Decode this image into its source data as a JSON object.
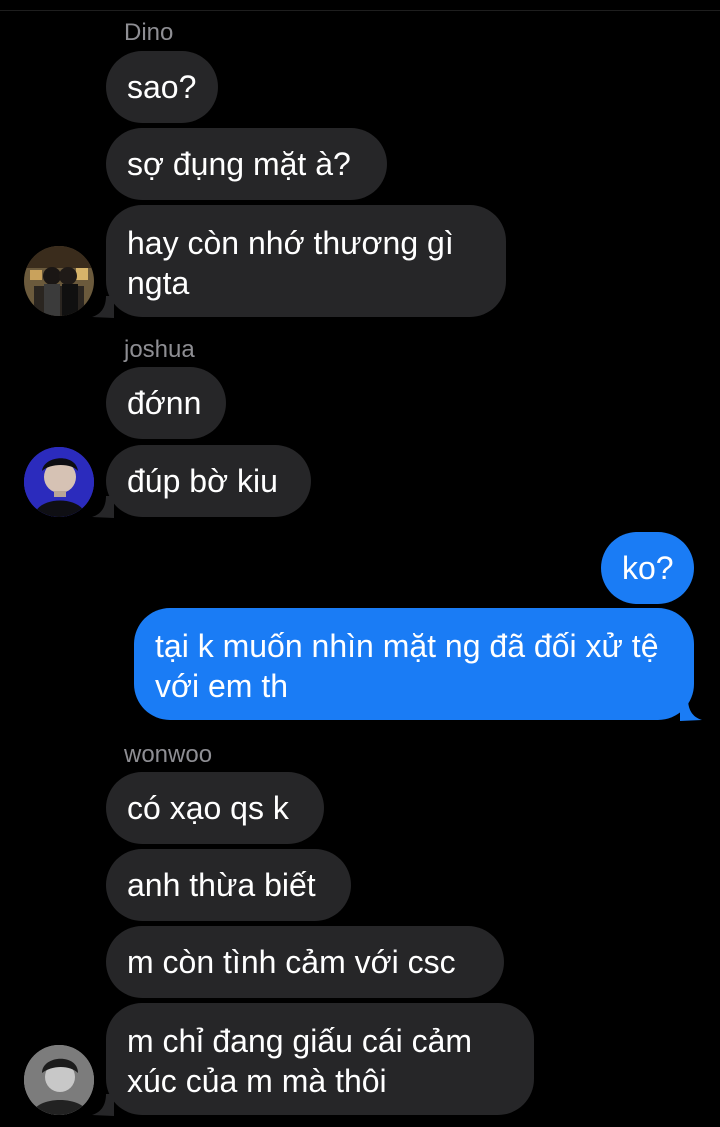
{
  "colors": {
    "background": "#000000",
    "incoming_bubble": "#262628",
    "outgoing_bubble": "#1a7cf5",
    "sender_name": "#8e8e93"
  },
  "groups": [
    {
      "sender": "Dino",
      "avatar": "dino-avatar-photo",
      "messages": [
        "sao?",
        "sợ đụng mặt à?",
        "hay còn nhớ thương gì ngta"
      ]
    },
    {
      "sender": "joshua",
      "avatar": "joshua-avatar-photo",
      "messages": [
        "đớnn",
        "đúp bờ kiu"
      ]
    },
    {
      "sender": "",
      "outgoing": true,
      "messages": [
        "ko?",
        "tại k muốn nhìn mặt ng đã đối xử tệ với em th"
      ]
    },
    {
      "sender": "wonwoo",
      "avatar": "wonwoo-avatar-photo",
      "messages": [
        "có xạo qs k",
        "anh thừa biết",
        "m còn tình cảm với csc",
        "m chỉ đang giấu cái cảm xúc của m mà thôi"
      ]
    }
  ]
}
